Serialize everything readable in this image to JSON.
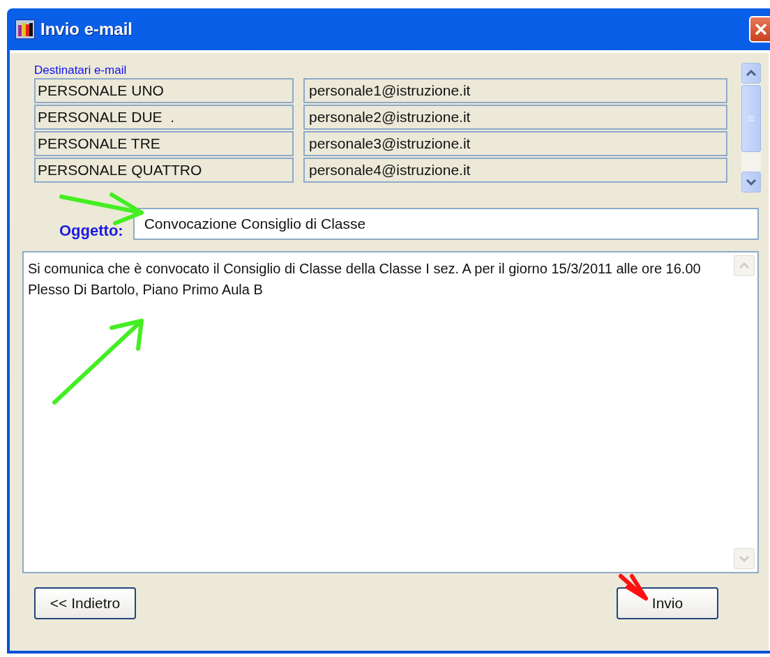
{
  "window": {
    "title": "Invio e-mail"
  },
  "recipients": {
    "label": "Destinatari e-mail",
    "rows": [
      {
        "name": "PERSONALE UNO",
        "email": "personale1@istruzione.it"
      },
      {
        "name": "PERSONALE DUE  .",
        "email": "personale2@istruzione.it"
      },
      {
        "name": "PERSONALE TRE",
        "email": "personale3@istruzione.it"
      },
      {
        "name": "PERSONALE QUATTRO",
        "email": "personale4@istruzione.it"
      }
    ]
  },
  "subject": {
    "label": "Oggetto:",
    "value": "Convocazione Consiglio di Classe"
  },
  "message": {
    "value": "Si comunica che è convocato il Consiglio di Classe della Classe I sez. A per il giorno 15/3/2011 alle ore 16.00 Plesso Di Bartolo, Piano Primo Aula B"
  },
  "buttons": [
    {
      "label": "<< Indietro"
    },
    {
      "label": "Invio"
    }
  ]
}
